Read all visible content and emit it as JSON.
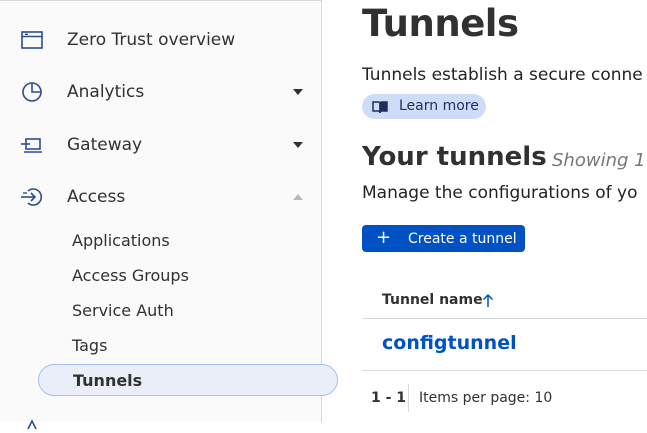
{
  "sidebar": {
    "items": [
      {
        "label": "Zero Trust overview",
        "icon": "browser-window-icon"
      },
      {
        "label": "Analytics",
        "icon": "pie-chart-icon",
        "caret": "down"
      },
      {
        "label": "Gateway",
        "icon": "gateway-icon",
        "caret": "down"
      },
      {
        "label": "Access",
        "icon": "access-sign-in-icon",
        "caret": "up"
      }
    ],
    "access_subitems": [
      "Applications",
      "Access Groups",
      "Service Auth",
      "Tags",
      "Tunnels"
    ],
    "active_subitem": "Tunnels"
  },
  "main": {
    "title": "Tunnels",
    "description": "Tunnels establish a secure conne",
    "learn_more": "Learn more",
    "section_title": "Your tunnels",
    "showing_text": "Showing 1",
    "manage_text": "Manage the configurations of yo",
    "create_button": "Create a tunnel",
    "table": {
      "column_header": "Tunnel name",
      "rows": [
        {
          "name": "configtunnel"
        }
      ]
    },
    "pagination": {
      "range": "1 - 1",
      "items_per_page": "Items per page: 10"
    }
  },
  "colors": {
    "accent": "#0051c3",
    "pill_bg": "#cfdcf7",
    "active_bg": "#e9eef9"
  }
}
